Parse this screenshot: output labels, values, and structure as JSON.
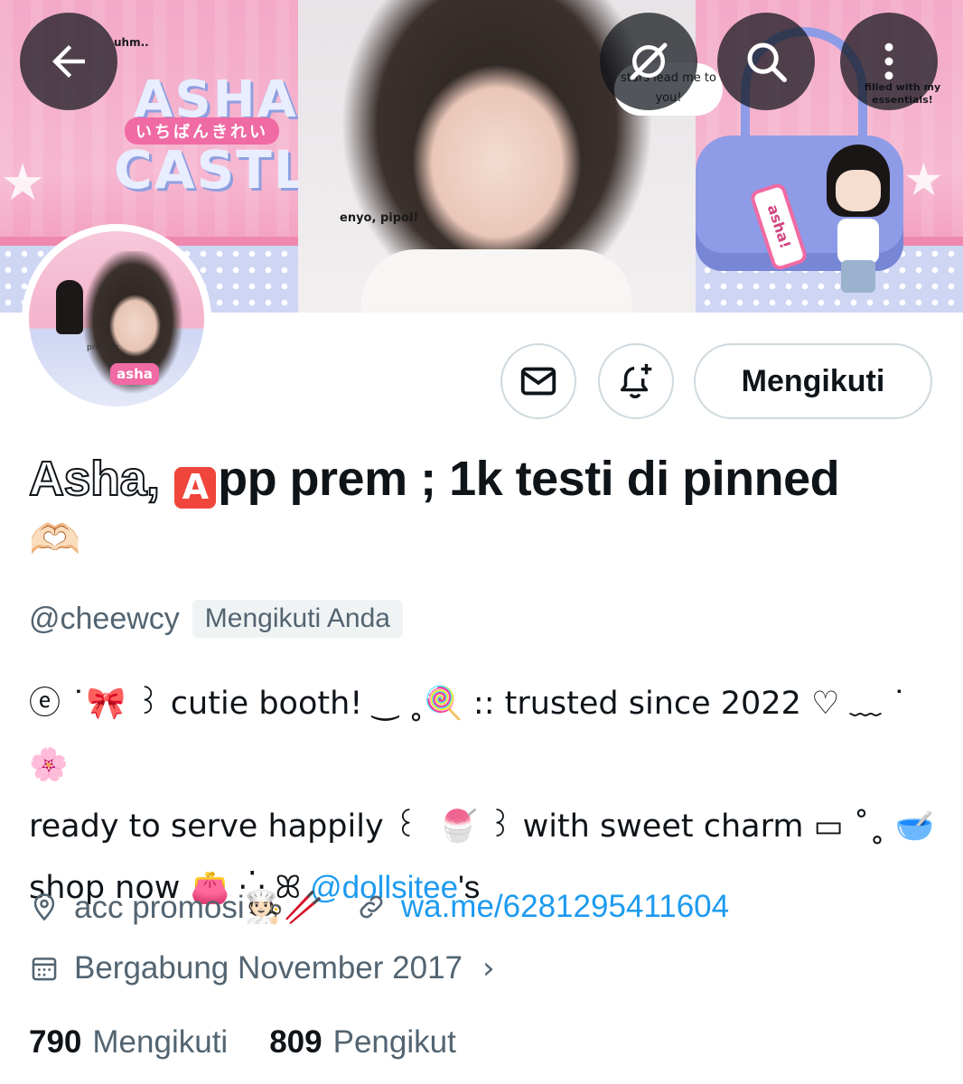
{
  "banner": {
    "logo_top": "ASHA",
    "logo_mid": "いちばんきれい",
    "logo_bottom": "CASTLE",
    "bubble_left": "uhm..",
    "bubble_top": "stars lead me to you!",
    "bubble_right": "filled with my essentials!",
    "greeting": "enyo, pipol!",
    "tag_text": "asha!"
  },
  "nav": {
    "back_icon": "arrow-left-icon",
    "grok_icon": "grok-icon",
    "search_icon": "search-icon",
    "more_icon": "more-vertical-icon"
  },
  "avatar": {
    "badge": "asha",
    "label": "premier"
  },
  "actions": {
    "message_icon": "mail-icon",
    "notify_icon": "bell-plus-icon",
    "follow_label": "Mengikuti"
  },
  "profile": {
    "name_prefix": "Asha,",
    "name_badge": "A",
    "name_rest": "pp prem ; 1k testi di pinned",
    "name_emoji": "🫶🏻",
    "handle": "@cheewcy",
    "follows_you": "Mengikuti Anda"
  },
  "bio": {
    "line1_a": "ⓔ ˙🎀 ꒱ cutie booth! ‿ ˳🍭 :: trusted since 2022 ♡ ﹏ ˙ 🌸",
    "line2_a": "ready to serve happily ꒰ ͏ 🍧 ꒱ with sweet charm ▭ ˚˳ 🥣",
    "line3_a": "shop now 👛 ⁛ ꕤ",
    "mention": "@dollsitee",
    "line3_b": "'s"
  },
  "meta": {
    "location_icon": "location-pin-icon",
    "location": "acc promosi🧑🏻‍🍳🥢",
    "link_icon": "link-icon",
    "link": "wa.me/6281295411604",
    "joined_icon": "calendar-icon",
    "joined": "Bergabung November 2017",
    "chevron": "›"
  },
  "stats": {
    "following_count": "790",
    "following_label": "Mengikuti",
    "followers_count": "809",
    "followers_label": "Pengikut"
  },
  "colors": {
    "accent": "#1d9bf0",
    "text": "#0f1419",
    "muted": "#536471",
    "border": "#cfd9de"
  }
}
